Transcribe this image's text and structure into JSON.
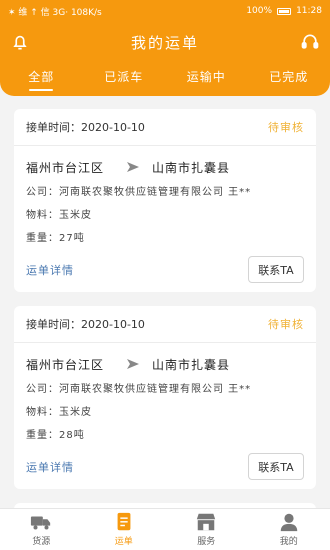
{
  "status_bar": {
    "left": "✶ 维 ↑ 信 3G· 108K/s",
    "right_battery": "100%",
    "time": "11:28"
  },
  "header": {
    "title": "我的运单",
    "left_icon": "bell-icon",
    "right_icon": "headset-icon"
  },
  "tabs": [
    {
      "label": "全部",
      "active": true
    },
    {
      "label": "已派车",
      "active": false
    },
    {
      "label": "运输中",
      "active": false
    },
    {
      "label": "已完成",
      "active": false
    }
  ],
  "orders": [
    {
      "date_label": "接单时间：",
      "date": "2020-10-10",
      "status": "待审核",
      "from": "福州市台江区",
      "to": "山南市扎囊县",
      "company": "公司：河南联农聚牧供应链管理有限公司 王**",
      "material": "物料：玉米皮",
      "weight": "重量：27吨",
      "detail_link": "运单详情",
      "contact_button": "联系TA"
    },
    {
      "date_label": "接单时间：",
      "date": "2020-10-10",
      "status": "待审核",
      "from": "福州市台江区",
      "to": "山南市扎囊县",
      "company": "公司：河南联农聚牧供应链管理有限公司 王**",
      "material": "物料：玉米皮",
      "weight": "重量：28吨",
      "detail_link": "运单详情",
      "contact_button": "联系TA"
    }
  ],
  "bottom_nav": [
    {
      "label": "货源",
      "icon": "truck-icon",
      "active": false
    },
    {
      "label": "运单",
      "icon": "document-icon",
      "active": true
    },
    {
      "label": "服务",
      "icon": "store-icon",
      "active": false
    },
    {
      "label": "我的",
      "icon": "user-icon",
      "active": false
    }
  ],
  "colors": {
    "brand": "#f6990e",
    "pending": "#f0b236",
    "link": "#4a78b0"
  }
}
